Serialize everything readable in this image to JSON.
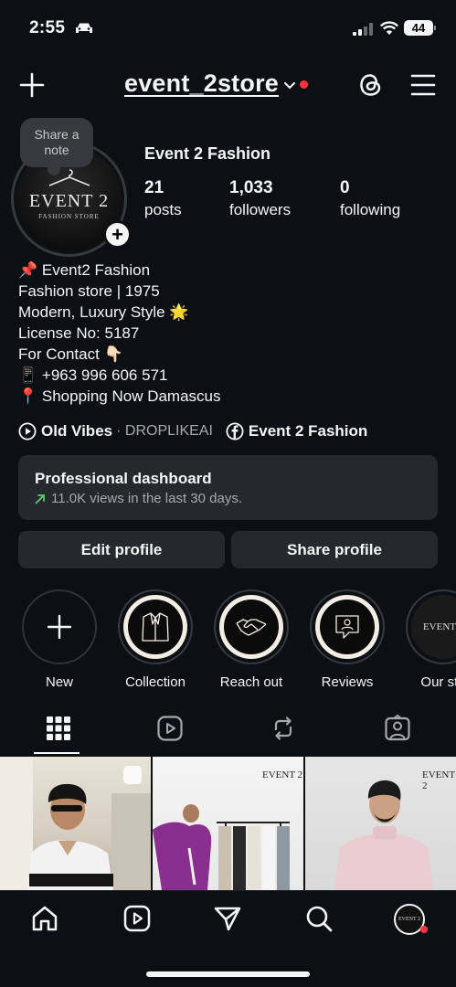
{
  "status": {
    "time": "2:55",
    "battery": "44"
  },
  "header": {
    "username": "event_2store",
    "icons": [
      "plus-icon",
      "chevron-down-icon",
      "threads-icon",
      "menu-icon"
    ]
  },
  "profile": {
    "note_prompt": "Share a note",
    "avatar_text_main": "EVENT 2",
    "avatar_text_sub": "FASHION STORE",
    "display_name": "Event 2 Fashion",
    "stats": [
      {
        "value": "21",
        "label": "posts"
      },
      {
        "value": "1,033",
        "label": "followers"
      },
      {
        "value": "0",
        "label": "following"
      }
    ],
    "bio": [
      "📌 Event2 Fashion",
      "Fashion store | 1975",
      "Modern, Luxury Style 🌟",
      "License No: 5187",
      "For Contact 👇🏻",
      "📱 +963 996 606 571",
      "📍 Shopping Now Damascus"
    ],
    "music_title": "Old Vibes",
    "music_artist": "· DROPLIKEAI",
    "facebook_name": "Event 2 Fashion"
  },
  "dashboard": {
    "title": "Professional dashboard",
    "subtitle": "11.0K views in the last 30 days."
  },
  "actions": {
    "edit_label": "Edit profile",
    "share_label": "Share profile"
  },
  "highlights": [
    {
      "label": "New",
      "icon": "plus-icon"
    },
    {
      "label": "Collection",
      "icon": "jacket-icon"
    },
    {
      "label": "Reach out",
      "icon": "handshake-icon"
    },
    {
      "label": "Reviews",
      "icon": "review-icon"
    },
    {
      "label": "Our sto",
      "icon": "logo-icon"
    }
  ],
  "tabs": [
    "grid-icon",
    "reels-icon",
    "repost-icon",
    "tagged-icon"
  ],
  "grid_posts": [
    {
      "type": "reel"
    },
    {
      "type": "photo",
      "brand": "EVENT 2"
    },
    {
      "type": "photo",
      "brand": "EVENT 2"
    }
  ],
  "bottom_nav": [
    "home-icon",
    "reels-icon",
    "send-icon",
    "search-icon",
    "profile-avatar"
  ],
  "colors": {
    "background": "#0c1014",
    "card": "#25292e",
    "accent_red": "#ff3040",
    "trend_green": "#5bd27a"
  }
}
